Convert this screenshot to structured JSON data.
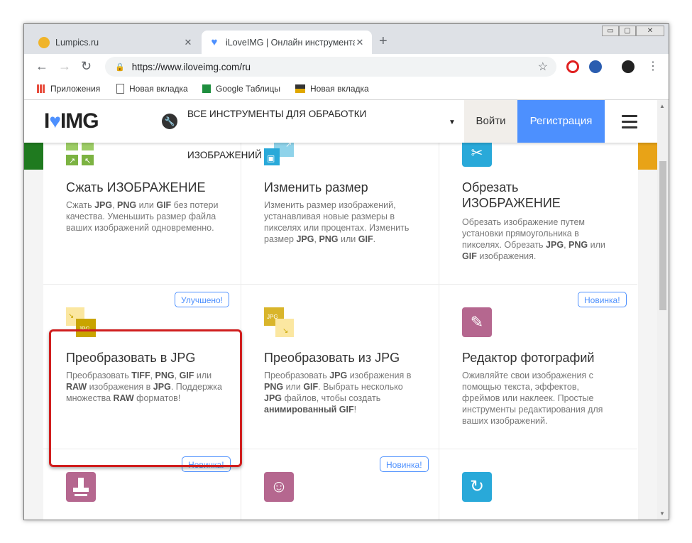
{
  "browser": {
    "tabs": [
      {
        "title": "Lumpics.ru",
        "close": "✕"
      },
      {
        "title": "iLoveIMG | Онлайн инструмента",
        "close": "✕"
      }
    ],
    "new_tab": "+",
    "window_controls": [
      "▭",
      "▢",
      "✕"
    ],
    "url": "https://www.iloveimg.com/ru",
    "bookmarks": [
      {
        "label": "Приложения",
        "icon": "apps-grid-icon"
      },
      {
        "label": "Новая вкладка",
        "icon": "page-icon"
      },
      {
        "label": "Google Таблицы",
        "icon": "sheets-icon"
      },
      {
        "label": "Новая вкладка",
        "icon": "image-icon"
      }
    ]
  },
  "site": {
    "logo_left": "I",
    "logo_heart": "♥",
    "logo_right": "IMG",
    "all_tools": "ВСЕ ИНСТРУМЕНТЫ ДЛЯ ОБРАБОТКИ ИЗОБРАЖЕНИЙ",
    "login": "Войти",
    "register": "Регистрация"
  },
  "cards": [
    {
      "title": "Сжать ИЗОБРАЖЕНИЕ",
      "desc": "Сжать JPG, PNG или GIF без потери качества. Уменьшить размер файла ваших изображений одновременно.",
      "color": "#7cb342"
    },
    {
      "title": "Изменить размер",
      "desc": "Изменить размер изображений, устанавливая новые размеры в пикселях или процентах. Изменить размер JPG, PNG или GIF.",
      "color": "#3bb0d9"
    },
    {
      "title": "Обрезать ИЗОБРАЖЕНИЕ",
      "desc": "Обрезать изображение путем установки прямоугольника в пикселях. Обрезать JPG, PNG или GIF изображения.",
      "color": "#29a9d9"
    },
    {
      "title": "Преобразовать в JPG",
      "desc": "Преобразовать TIFF, PNG, GIF или RAW изображения в JPG. Поддержка множества RAW форматов!",
      "badge": "Улучшено!",
      "icon_text": "JPG",
      "color": "#c9a400"
    },
    {
      "title": "Преобразовать из JPG",
      "desc": "Преобразовать JPG изображения в PNG или GIF. Выбрать несколько JPG файлов, чтобы создать анимированный GIF!",
      "icon_text": "JPG",
      "color": "#d9b52b"
    },
    {
      "title": "Редактор фотографий",
      "desc": "Оживляйте свои изображения с помощью текста, эффектов, фреймов или наклеек. Простые инструменты редактирования для ваших изображений.",
      "badge": "Новинка!",
      "color": "#b5678f"
    },
    {
      "badge": "Новинка!",
      "color": "#b5678f"
    },
    {
      "badge": "Новинка!",
      "color": "#b5678f"
    },
    {
      "color": "#29a9d9"
    }
  ]
}
